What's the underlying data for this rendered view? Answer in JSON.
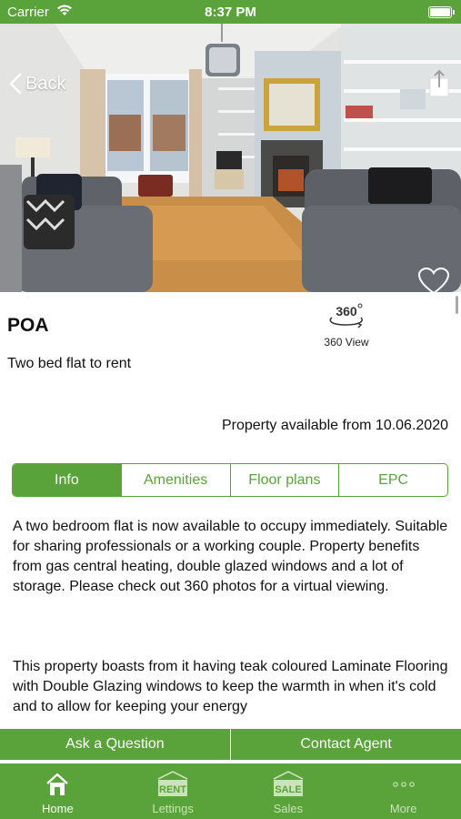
{
  "status_bar": {
    "carrier": "Carrier",
    "time": "8:37 PM"
  },
  "nav": {
    "back_label": "Back"
  },
  "property": {
    "price": "POA",
    "title": "Two bed flat to rent",
    "availability": "Property available from 10.06.2020",
    "view360_label": "360 View"
  },
  "tabs": [
    {
      "label": "Info",
      "active": true
    },
    {
      "label": "Amenities",
      "active": false
    },
    {
      "label": "Floor plans",
      "active": false
    },
    {
      "label": "EPC",
      "active": false
    }
  ],
  "description": {
    "paragraph1": "A two bedroom flat is now available to occupy immediately. Suitable for sharing professionals or a working couple. Property benefits from gas central heating, double glazed windows and a lot of storage. Please check out 360 photos for a virtual viewing.",
    "paragraph2": "This property boasts from it having teak coloured Laminate Flooring with Double Glazing windows to keep the warmth in when it's cold and to allow for keeping your energy"
  },
  "actions": {
    "ask_question": "Ask a Question",
    "contact_agent": "Contact Agent"
  },
  "tab_bar": [
    {
      "label": "Home",
      "icon": "home-icon",
      "active": true
    },
    {
      "label": "Lettings",
      "icon": "rent-sign-icon",
      "badge": "RENT",
      "active": false
    },
    {
      "label": "Sales",
      "icon": "sale-sign-icon",
      "badge": "SALE",
      "active": false
    },
    {
      "label": "More",
      "icon": "more-dots-icon",
      "active": false
    }
  ],
  "colors": {
    "brand_green": "#5aa33a",
    "inactive_tab_text": "#c8e4b8"
  }
}
